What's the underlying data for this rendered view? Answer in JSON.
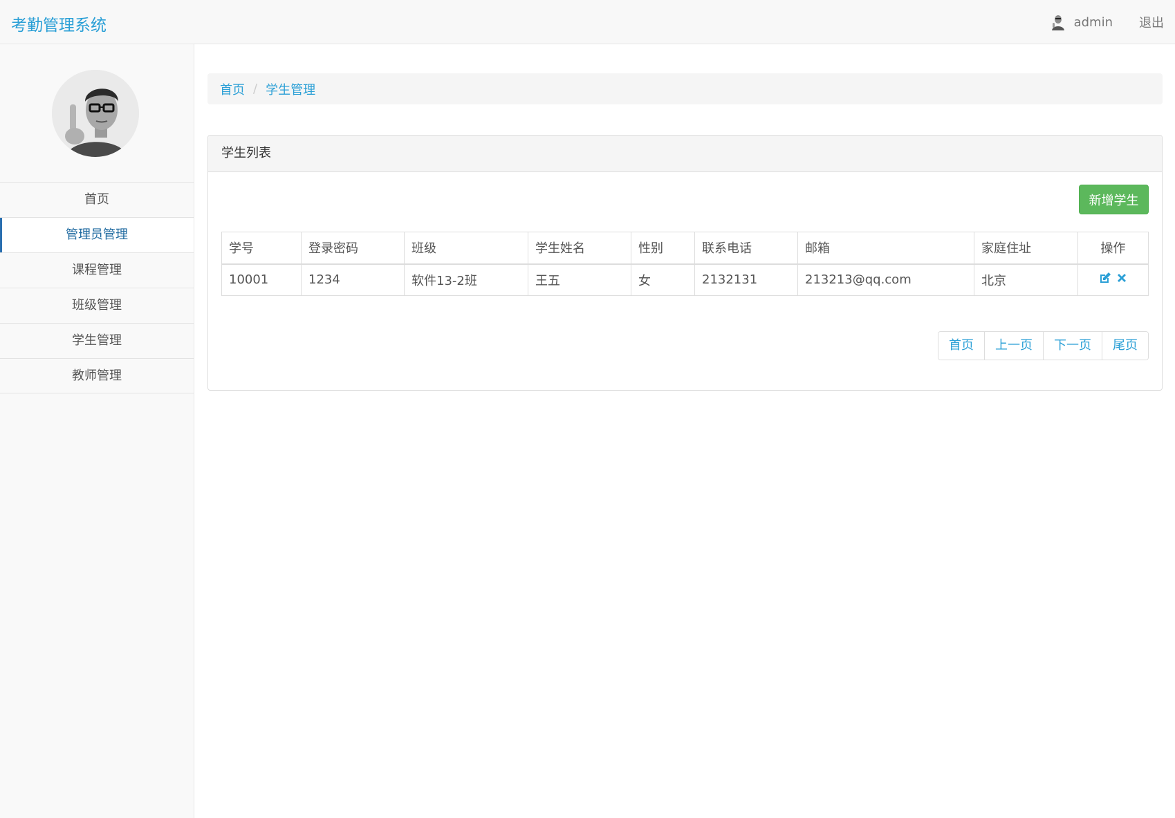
{
  "header": {
    "brand": "考勤管理系统",
    "username": "admin",
    "logout": "退出"
  },
  "sidebar": {
    "items": [
      {
        "label": "首页"
      },
      {
        "label": "管理员管理"
      },
      {
        "label": "课程管理"
      },
      {
        "label": "班级管理"
      },
      {
        "label": "学生管理"
      },
      {
        "label": "教师管理"
      }
    ],
    "active_index": 1
  },
  "breadcrumb": {
    "home": "首页",
    "separator": "/",
    "current": "学生管理"
  },
  "panel": {
    "title": "学生列表",
    "add_button": "新增学生"
  },
  "table": {
    "headers": [
      "学号",
      "登录密码",
      "班级",
      "学生姓名",
      "性别",
      "联系电话",
      "邮箱",
      "家庭住址",
      "操作"
    ],
    "rows": [
      [
        "10001",
        "1234",
        "软件13-2班",
        "王五",
        "女",
        "2132131",
        "213213@qq.com",
        "北京"
      ]
    ],
    "actions": [
      "edit-icon",
      "delete-icon"
    ]
  },
  "pagination": {
    "first": "首页",
    "prev": "上一页",
    "next": "下一页",
    "last": "尾页"
  },
  "colors": {
    "link": "#2a9fd6",
    "success": "#5cb85c",
    "active_menu": "#1f6aa0"
  }
}
